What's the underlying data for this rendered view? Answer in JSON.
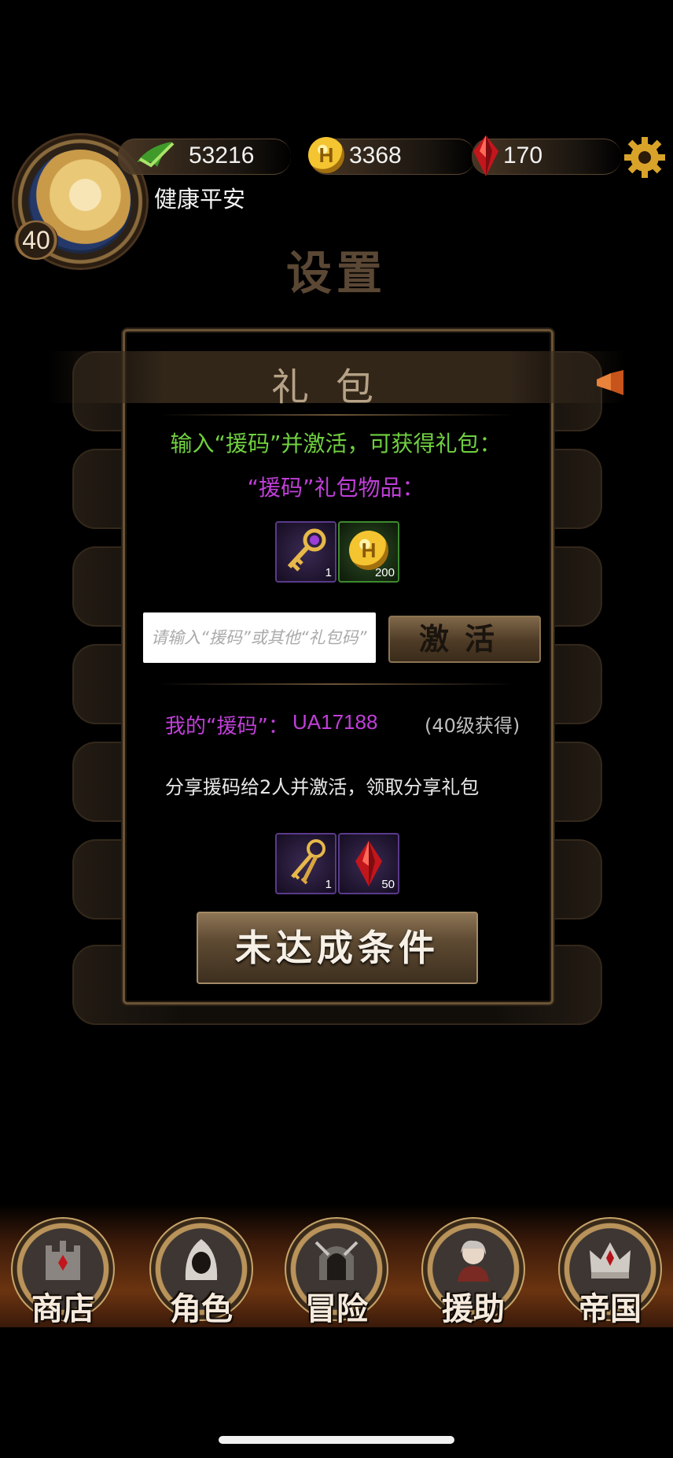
{
  "player": {
    "level": "40",
    "name": "健康平安",
    "stamina": "53216",
    "gold": "3368",
    "gems": "170"
  },
  "page": {
    "title": "设置"
  },
  "dialog": {
    "title": "礼包",
    "intro": "输入“援码”并激活，可获得礼包：",
    "items_label": "“援码”礼包物品：",
    "reward_items": [
      {
        "icon": "key-icon",
        "count": "1"
      },
      {
        "icon": "gold-coin-icon",
        "count": "200"
      }
    ],
    "code_input_placeholder": "请输入“援码”或其他“礼包码”",
    "activate_label": "激活",
    "my_code_label": "我的“援码”：",
    "my_code_value": "UA17188",
    "my_code_note": "(40级获得)",
    "share_text": "分享援码给2人并激活，领取分享礼包",
    "share_items": [
      {
        "icon": "keys-icon",
        "count": "1"
      },
      {
        "icon": "red-gem-icon",
        "count": "50"
      }
    ],
    "claim_label": "未达成条件"
  },
  "nav": [
    {
      "label": "商店",
      "icon": "castle-icon"
    },
    {
      "label": "角色",
      "icon": "hooded-figure-icon"
    },
    {
      "label": "冒险",
      "icon": "dungeon-gate-icon"
    },
    {
      "label": "援助",
      "icon": "helper-portrait-icon"
    },
    {
      "label": "帝国",
      "icon": "crown-icon"
    }
  ],
  "colors": {
    "accent_gold": "#8c7352",
    "intro_green": "#70d13f",
    "highlight_purple": "#c03fd8"
  }
}
